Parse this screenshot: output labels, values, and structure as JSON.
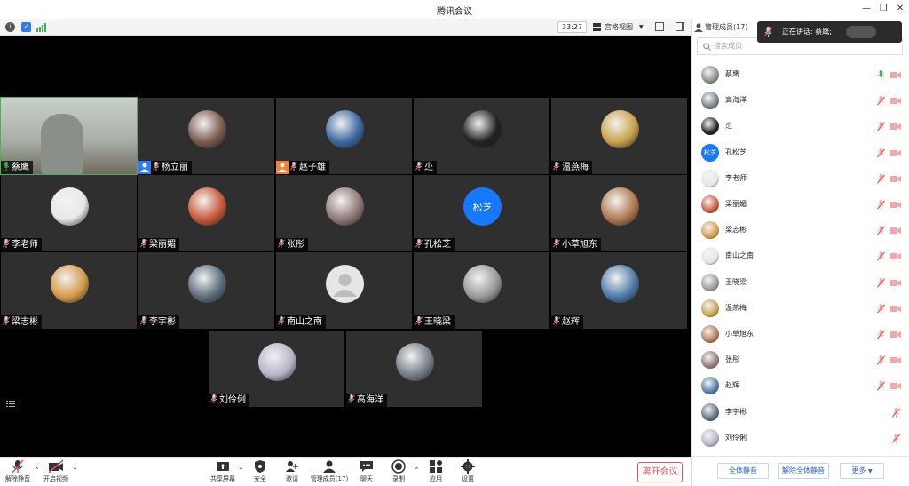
{
  "window": {
    "title": "腾讯会议"
  },
  "toolbar": {
    "timer": "33:27",
    "view_label": "宫格视图"
  },
  "tiles": [
    {
      "name": "蔡鹰",
      "host": false,
      "avatar": "video",
      "color": "#8a8f8a",
      "mic_color": "#4caf50"
    },
    {
      "name": "杨立丽",
      "host": true,
      "host_color": "#2d7cf6",
      "avatar": "photo",
      "color": "#7c5c4e"
    },
    {
      "name": "赵子雄",
      "host": true,
      "host_color": "#f5802e",
      "avatar": "photo",
      "color": "#3b6aa0"
    },
    {
      "name": "尐",
      "avatar": "photo",
      "color": "#222222"
    },
    {
      "name": "温燕梅",
      "avatar": "photo",
      "color": "#c9a24a"
    },
    {
      "name": "李老师",
      "avatar": "photo",
      "color": "#e8e8e8"
    },
    {
      "name": "梁丽媚",
      "avatar": "photo",
      "color": "#c85a3a"
    },
    {
      "name": "张彤",
      "avatar": "photo",
      "color": "#8f7a78"
    },
    {
      "name": "孔松芝",
      "avatar": "text",
      "avatar_text": "松芝",
      "color": "#1677ff"
    },
    {
      "name": "小草旭东",
      "avatar": "photo",
      "color": "#b07a52"
    },
    {
      "name": "梁志彬",
      "avatar": "photo",
      "color": "#d69a4a"
    },
    {
      "name": "李宇彬",
      "avatar": "photo",
      "color": "#5d6e7c"
    },
    {
      "name": "南山之南",
      "avatar": "default",
      "color": "#e6e6e6"
    },
    {
      "name": "王晓梁",
      "avatar": "photo",
      "color": "#9a9a9a"
    },
    {
      "name": "赵辉",
      "avatar": "photo",
      "color": "#4f7ba8"
    },
    {
      "name": "刘伶俐",
      "avatar": "photo",
      "color": "#b9b4c8"
    },
    {
      "name": "高海洋",
      "avatar": "photo",
      "color": "#777f88"
    }
  ],
  "bottombar": {
    "unmute": "解除静音",
    "start_video": "开启视频",
    "share_screen": "共享屏幕",
    "security": "安全",
    "invite": "邀请",
    "manage_members": "管理成员(17)",
    "chat": "聊天",
    "record": "录制",
    "apps": "应用",
    "settings": "设置",
    "leave": "离开会议"
  },
  "panel": {
    "title": "管理成员(17)",
    "search_placeholder": "搜索成员",
    "members": [
      {
        "name": "蔡鹰",
        "color": "#8a8f8a",
        "mic": "on",
        "cam": "off"
      },
      {
        "name": "高海洋",
        "color": "#777f88",
        "mic": "muted",
        "cam": "off"
      },
      {
        "name": "尐",
        "color": "#222222",
        "mic": "muted",
        "cam": "off"
      },
      {
        "name": "孔松芝",
        "color": "#1677ff",
        "avatar_text": "松芝",
        "mic": "muted",
        "cam": "off"
      },
      {
        "name": "李老师",
        "color": "#e8e8e8",
        "mic": "muted",
        "cam": "off"
      },
      {
        "name": "梁丽媚",
        "color": "#c85a3a",
        "mic": "muted",
        "cam": "off"
      },
      {
        "name": "梁志彬",
        "color": "#d69a4a",
        "mic": "muted",
        "cam": "off"
      },
      {
        "name": "南山之南",
        "color": "#e6e6e6",
        "mic": "muted",
        "cam": "off"
      },
      {
        "name": "王晓梁",
        "color": "#9a9a9a",
        "mic": "muted",
        "cam": "off"
      },
      {
        "name": "温燕梅",
        "color": "#c9a24a",
        "mic": "muted",
        "cam": "off"
      },
      {
        "name": "小草旭东",
        "color": "#b07a52",
        "mic": "muted",
        "cam": "off"
      },
      {
        "name": "张彤",
        "color": "#8f7a78",
        "mic": "muted",
        "cam": "off"
      },
      {
        "name": "赵辉",
        "color": "#4f7ba8",
        "mic": "muted",
        "cam": "off"
      },
      {
        "name": "李宇彬",
        "color": "#5d6e7c",
        "mic": "muted",
        "cam": "none"
      },
      {
        "name": "刘伶俐",
        "color": "#b9b4c8",
        "mic": "muted",
        "cam": "none"
      }
    ],
    "mute_all": "全体静音",
    "unmute_all": "解除全体静音",
    "more": "更多"
  },
  "toast": {
    "text": "正在讲话: 蔡鹰;"
  },
  "colors": {
    "accent": "#2a62d9",
    "leave": "#e25555",
    "speaking": "#4caf50",
    "muted": "#e25555"
  }
}
